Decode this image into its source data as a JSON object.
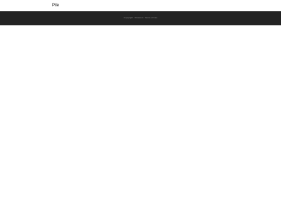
{
  "header": {
    "site_title": "Pile"
  },
  "footer": {
    "copyright": "Copyright · Powered · Terms of Use"
  }
}
